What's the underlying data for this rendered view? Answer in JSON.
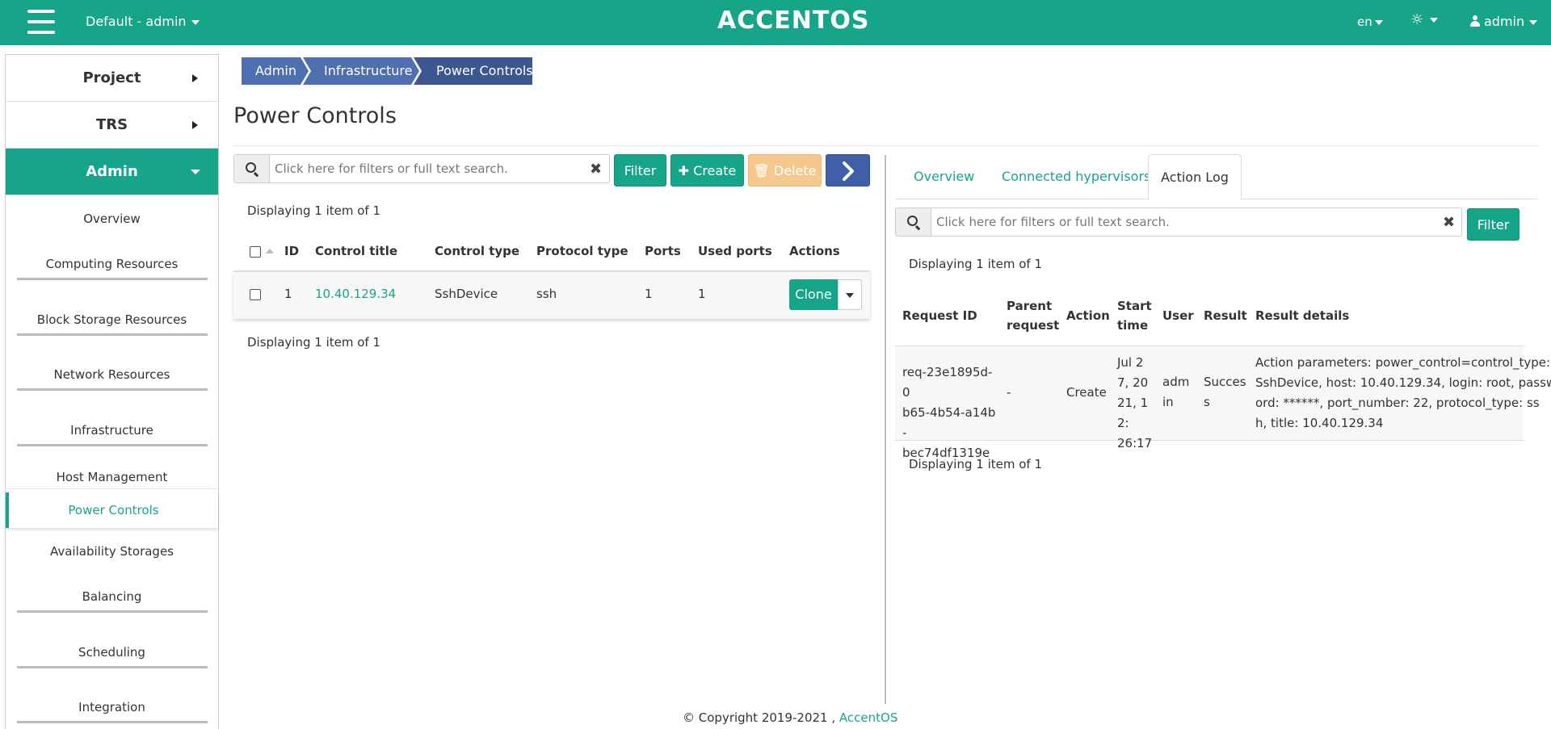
{
  "topbar": {
    "project": "Default - admin",
    "logo": "ACCENTOS",
    "lang": "en",
    "theme_icon": "sun-icon",
    "user": "admin"
  },
  "sidebar": {
    "sections": [
      {
        "label": "Project"
      },
      {
        "label": "TRS"
      },
      {
        "label": "Admin"
      }
    ],
    "items": [
      {
        "label": "Overview"
      },
      {
        "label": "Computing Resources"
      },
      {
        "label": "Block Storage Resources"
      },
      {
        "label": "Network Resources"
      },
      {
        "label": "Infrastructure"
      },
      {
        "label": "Host Management"
      },
      {
        "label": "Power Controls"
      },
      {
        "label": "Availability Storages"
      },
      {
        "label": "Balancing"
      },
      {
        "label": "Scheduling"
      },
      {
        "label": "Integration"
      }
    ]
  },
  "breadcrumb": [
    "Admin",
    "Infrastructure",
    "Power Controls"
  ],
  "page_title": "Power Controls",
  "left": {
    "search_placeholder": "Click here for filters or full text search.",
    "filter_label": "Filter",
    "create_label": "Create",
    "delete_label": "Delete",
    "display_top": "Displaying 1 item of 1",
    "display_bottom": "Displaying 1 item of 1",
    "columns": [
      "ID",
      "Control title",
      "Control type",
      "Protocol type",
      "Ports",
      "Used ports",
      "Actions"
    ],
    "row": {
      "id": "1",
      "title": "10.40.129.34",
      "type": "SshDevice",
      "protocol": "ssh",
      "ports": "1",
      "used_ports": "1",
      "action": "Clone"
    }
  },
  "right": {
    "tabs": [
      "Overview",
      "Connected hypervisors",
      "Action Log"
    ],
    "search_placeholder": "Click here for filters or full text search.",
    "filter_label": "Filter",
    "display_top": "Displaying 1 item of 1",
    "display_bottom": "Displaying 1 item of 1",
    "columns": {
      "request_id": "Request ID",
      "parent_1": "Parent",
      "parent_2": "request",
      "action": "Action",
      "start_1": "Start",
      "start_2": "time",
      "user": "User",
      "result": "Result",
      "details": "Result details"
    },
    "row": {
      "request_id_lines": [
        "req-23e1895d-0",
        "b65-4b54-a14b-",
        "bec74df1319e"
      ],
      "parent": "-",
      "action": "Create",
      "start_lines": [
        "Jul 2",
        "7, 20",
        "21, 12:",
        "26:17"
      ],
      "user_lines": [
        "adm",
        "in"
      ],
      "result_lines": [
        "Succes",
        "s"
      ],
      "details_lines": [
        "Action parameters: power_control=control_type:",
        "SshDevice, host: 10.40.129.34, login: root, passw",
        "ord: ******, port_number: 22, protocol_type: ss",
        "h, title: 10.40.129.34"
      ]
    }
  },
  "footer": {
    "text": "© Copyright 2019-2021 ,",
    "link": "AccentOS"
  },
  "colors": {
    "accent": "#17a589",
    "breadcrumb": "#4f6fb0",
    "breadcrumb_active": "#3d5590"
  }
}
